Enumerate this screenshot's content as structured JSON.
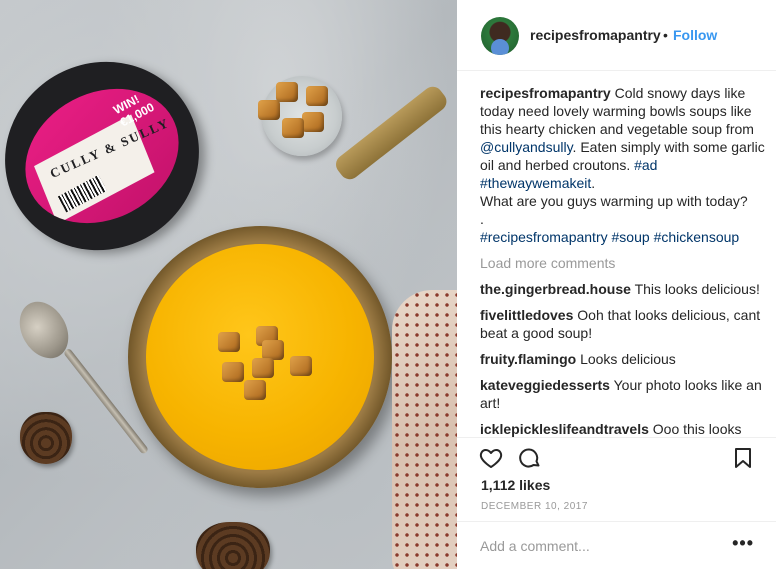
{
  "post": {
    "username": "recipesfromapantry",
    "follow_label": "Follow",
    "separator": "•",
    "photo_alt": "Bowl of yellow soup with croutons"
  },
  "product": {
    "brand": "CULLY & SULLY",
    "promo": "WIN! €1,000"
  },
  "caption": {
    "user": "recipesfromapantry",
    "text_1": "Cold snowy days like today need lovely warming bowls soups like this hearty chicken and vegetable soup from",
    "mention": "@cullyandsully",
    "text_2": ". Eaten simply with some garlic oil and herbed croutons.",
    "tag_ad": "#ad",
    "tag_way": "#thewaywemakeit",
    "text_3": ".",
    "question": "What are you guys warming up with today?",
    "dot_line": ".",
    "tag_recipes": "#recipesfromapantry",
    "tag_soup": "#soup",
    "tag_chicken": "#chickensoup"
  },
  "load_more": "Load more comments",
  "comments": [
    {
      "user": "the.gingerbread.house",
      "text": "This looks delicious!"
    },
    {
      "user": "fivelittledoves",
      "text": "Ooh that looks delicious, cant beat a good soup!"
    },
    {
      "user": "fruity.flamingo",
      "text": "Looks delicious"
    },
    {
      "user": "kateveggiedesserts",
      "text": "Your photo looks like an art!"
    },
    {
      "user": "icklepickleslifeandtravels",
      "text": "Ooo this looks"
    }
  ],
  "actions": {
    "like_icon": "heart-icon",
    "comment_icon": "comment-bubble-icon",
    "save_icon": "bookmark-icon"
  },
  "likes": "1,112 likes",
  "date": "DECEMBER 10, 2017",
  "add_comment": {
    "placeholder": "Add a comment...",
    "more_label": "•••"
  }
}
